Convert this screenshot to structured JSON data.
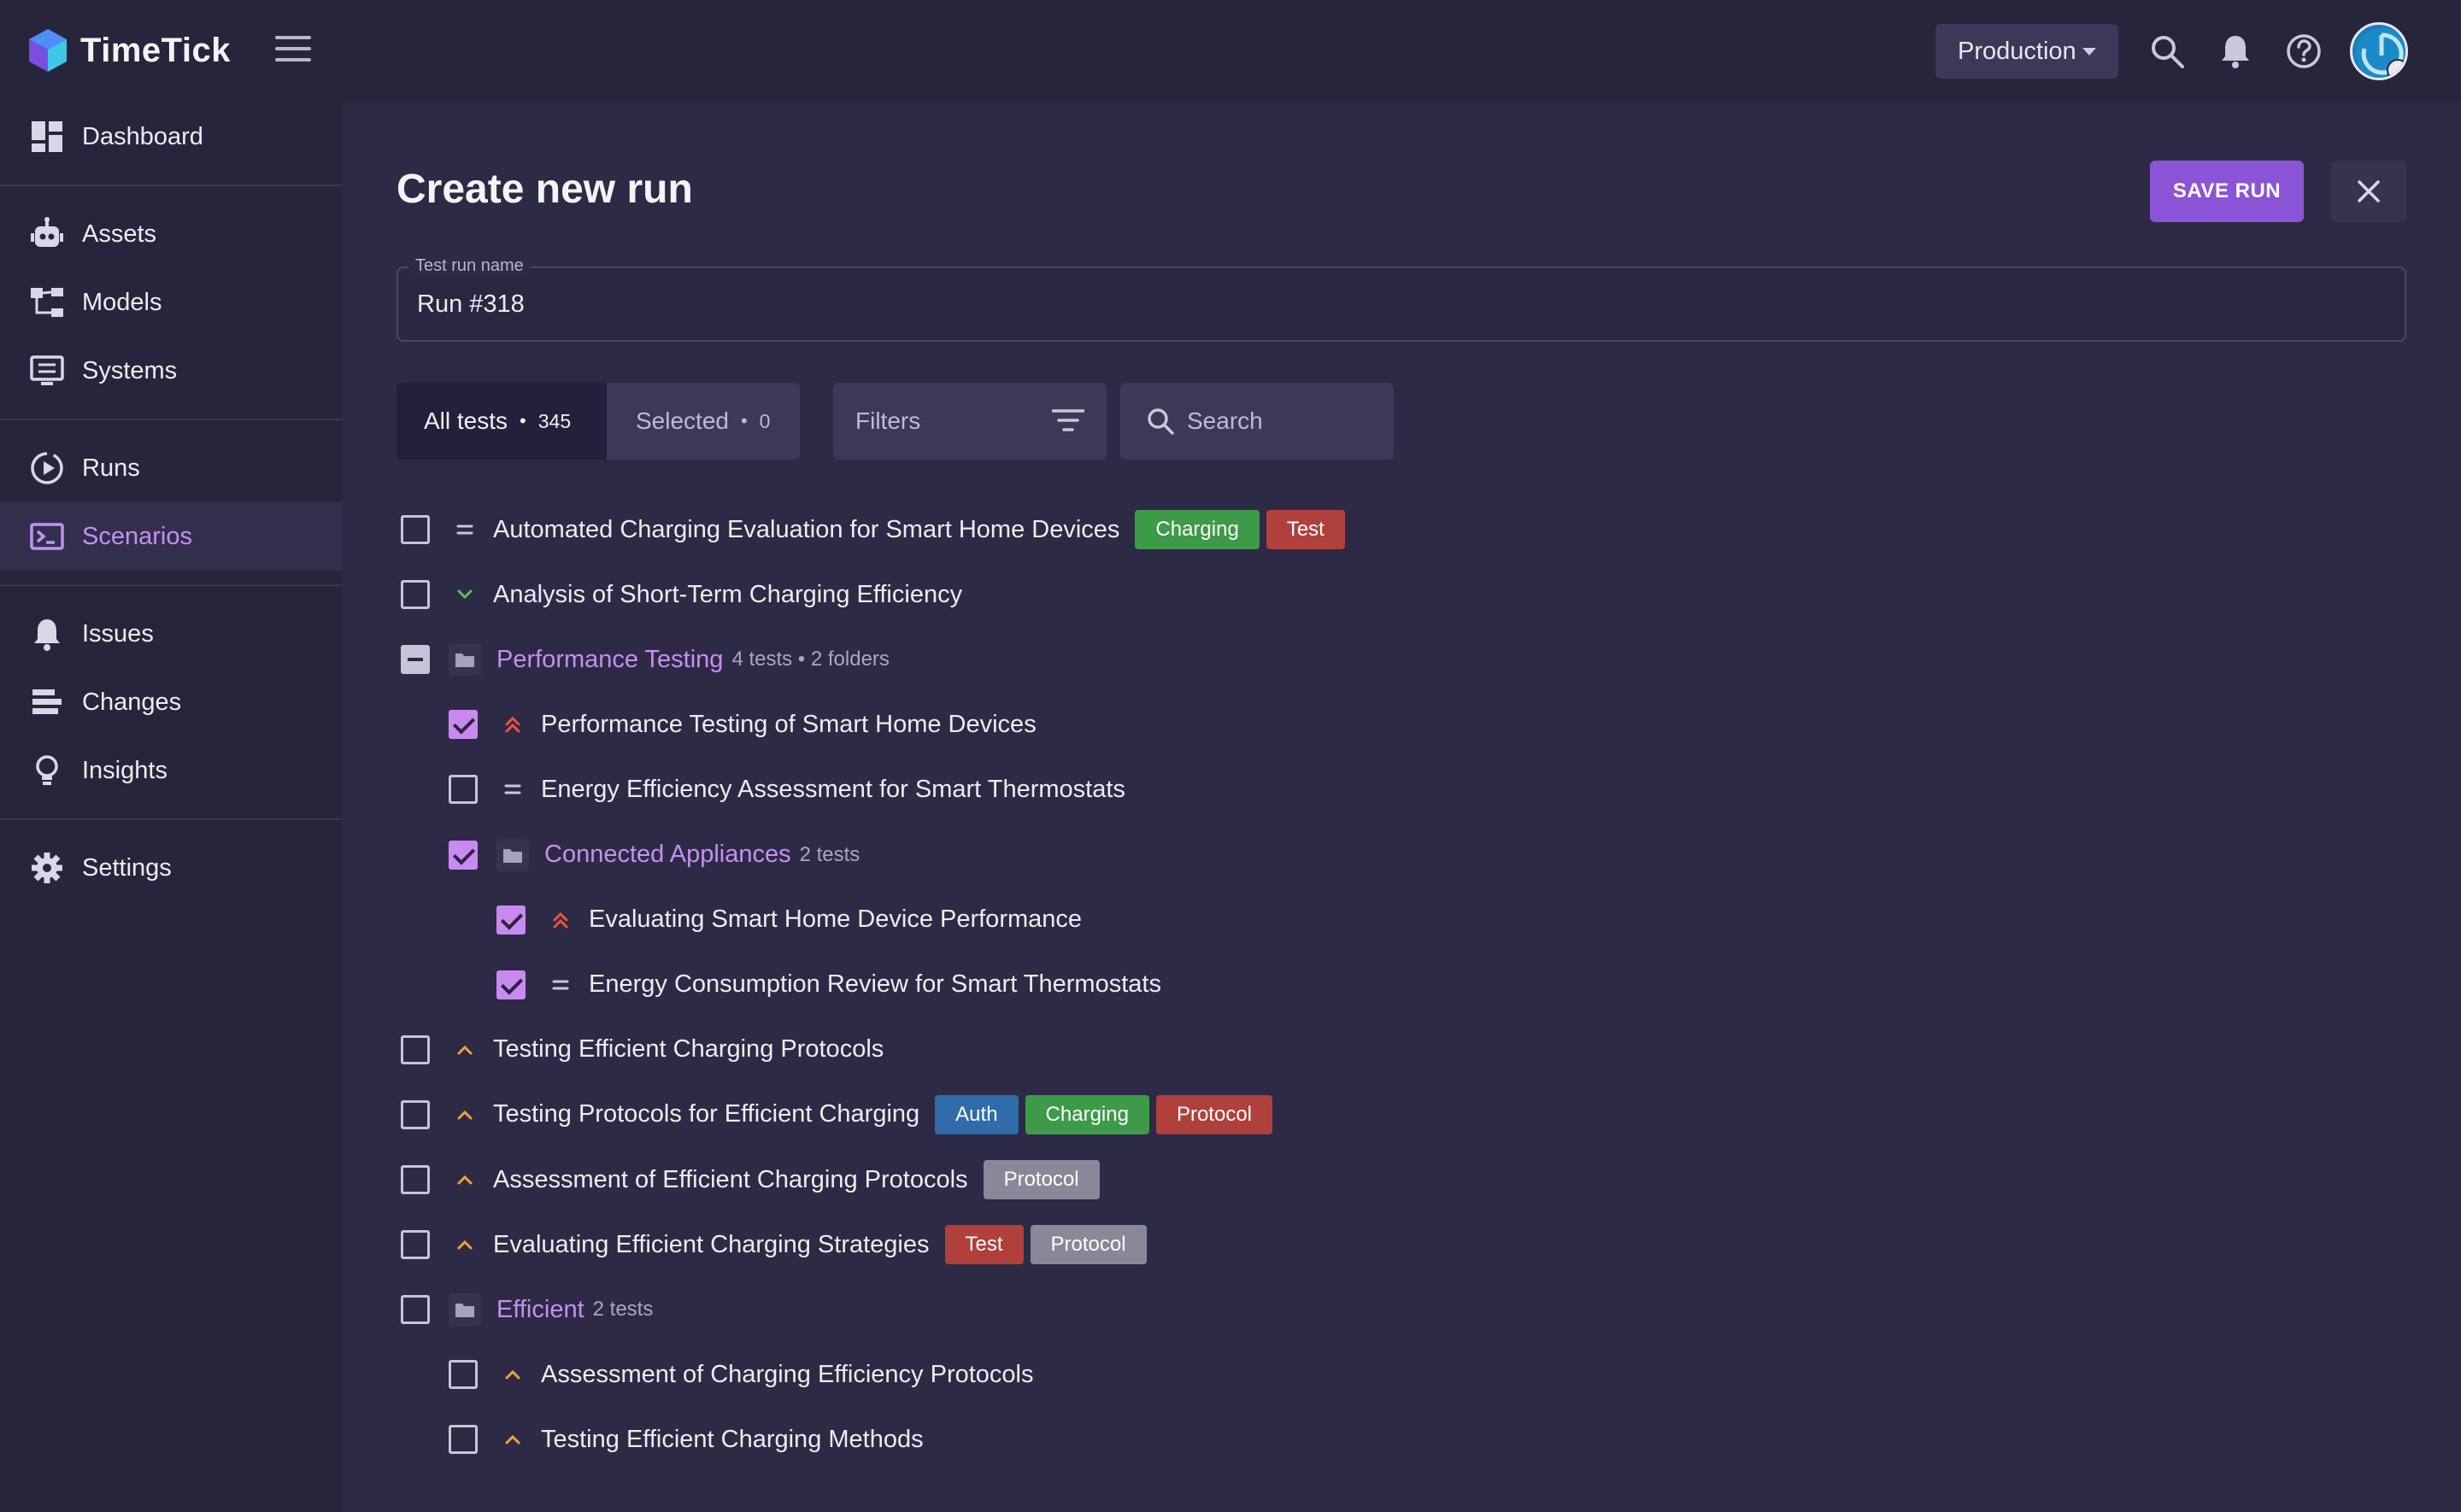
{
  "app": {
    "name": "TimeTick"
  },
  "header": {
    "environment": "Production"
  },
  "sidebar": {
    "items": [
      {
        "label": "Dashboard",
        "icon": "dashboard-icon"
      },
      {
        "label": "Assets",
        "icon": "robot-icon"
      },
      {
        "label": "Models",
        "icon": "hierarchy-icon"
      },
      {
        "label": "Systems",
        "icon": "monitor-icon"
      },
      {
        "label": "Runs",
        "icon": "play-circle-icon"
      },
      {
        "label": "Scenarios",
        "icon": "terminal-icon",
        "active": true
      },
      {
        "label": "Issues",
        "icon": "bell-icon"
      },
      {
        "label": "Changes",
        "icon": "stack-icon"
      },
      {
        "label": "Insights",
        "icon": "lightbulb-icon"
      },
      {
        "label": "Settings",
        "icon": "gear-icon"
      }
    ]
  },
  "page": {
    "title": "Create new run",
    "save_label": "SAVE RUN",
    "name_field": {
      "label": "Test run name",
      "value": "Run #318"
    },
    "tabs": {
      "all": {
        "label": "All tests",
        "count": "345"
      },
      "selected": {
        "label": "Selected",
        "count": "0"
      }
    },
    "filters_label": "Filters",
    "search_placeholder": "Search"
  },
  "colors": {
    "accent": "#8b54d6",
    "tag_green": "#3d9a48",
    "tag_red": "#b0403c",
    "tag_blue": "#2f6ca9",
    "tag_gray": "#8a8898",
    "prio_high": "#e8553f",
    "prio_medium": "#f0a03c",
    "prio_low": "#5fbf56"
  },
  "tests": [
    {
      "title": "Automated Charging Evaluation for Smart Home Devices",
      "priority": "normal",
      "checked": "none",
      "tags": [
        "Charging",
        "Test"
      ]
    },
    {
      "title": "Analysis of Short-Term Charging Efficiency",
      "priority": "low",
      "checked": "none"
    },
    {
      "title": "Performance Testing",
      "folder": true,
      "meta": "4 tests • 2 folders",
      "checked": "partial"
    },
    {
      "title": "Performance Testing of Smart Home Devices",
      "priority": "high",
      "checked": "checked"
    },
    {
      "title": "Energy Efficiency Assessment for Smart Thermostats",
      "priority": "normal",
      "checked": "none"
    },
    {
      "title": "Connected Appliances",
      "folder": true,
      "meta": "2 tests",
      "checked": "checked"
    },
    {
      "title": "Evaluating Smart Home Device Performance",
      "priority": "high",
      "checked": "checked"
    },
    {
      "title": "Energy Consumption Review for Smart Thermostats",
      "priority": "normal",
      "checked": "checked"
    },
    {
      "title": "Testing Efficient Charging Protocols",
      "priority": "medium",
      "checked": "none"
    },
    {
      "title": "Testing Protocols for Efficient Charging",
      "priority": "medium",
      "checked": "none",
      "tags": [
        "Auth",
        "Charging",
        "Protocol"
      ]
    },
    {
      "title": "Assessment of Efficient Charging Protocols",
      "priority": "medium",
      "checked": "none",
      "tags": [
        "Protocol"
      ]
    },
    {
      "title": "Evaluating Efficient Charging Strategies",
      "priority": "medium",
      "checked": "none",
      "tags": [
        "Test",
        "Protocol"
      ]
    },
    {
      "title": "Efficient",
      "folder": true,
      "meta": "2 tests",
      "checked": "none"
    },
    {
      "title": "Assessment of Charging Efficiency Protocols",
      "priority": "medium",
      "checked": "none"
    },
    {
      "title": "Testing Efficient Charging Methods",
      "priority": "medium",
      "checked": "none"
    }
  ],
  "tag_colors": {
    "Charging": "#3d9a48",
    "Test": "#b0403c",
    "Auth": "#2f6ca9",
    "Protocol": "#b0403c"
  }
}
